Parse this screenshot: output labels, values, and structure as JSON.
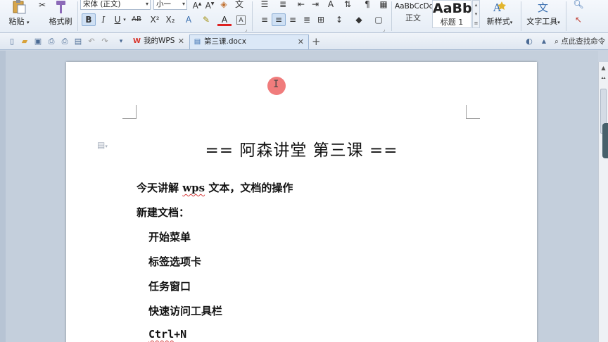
{
  "ribbon": {
    "paste_label": "粘贴",
    "format_painter_label": "格式刷",
    "font_name": "宋体 (正文)",
    "font_size": "小一",
    "bold": "B",
    "italic": "I",
    "underline": "U",
    "strike": "AB",
    "superscript": "X²",
    "subscript": "X₂",
    "styles": {
      "normal_sample": "AaBbCcDd",
      "normal_label": "正文",
      "heading1_sample": "AaBb",
      "heading1_label": "标题 1",
      "new_style_label": "新样式",
      "text_tools_label": "文字工具"
    }
  },
  "qbar": {
    "tabs": [
      {
        "label": "我的WPS",
        "active": false
      },
      {
        "label": "第三课.docx",
        "active": true
      }
    ],
    "find_command": "点此查找命令"
  },
  "document": {
    "title": "== 阿森讲堂 第三课 ==",
    "lines": [
      {
        "text": "今天讲解 wps 文本，文档的操作"
      },
      {
        "text": "新建文档："
      },
      {
        "text": "开始菜单"
      },
      {
        "text": "标签选项卡"
      },
      {
        "text": "任务窗口"
      },
      {
        "text": "快速访问工具栏"
      },
      {
        "text": "Ctrl+N"
      }
    ],
    "line1_parts": [
      "今天讲解 ",
      "wps",
      " 文本，文档的操作"
    ],
    "line7_parts": [
      "Ctrl",
      "+N"
    ]
  },
  "colors": {
    "accent": "#3a6fb0",
    "cursor_highlight": "#ef6e6e",
    "spell_underline": "#d63b3b"
  }
}
